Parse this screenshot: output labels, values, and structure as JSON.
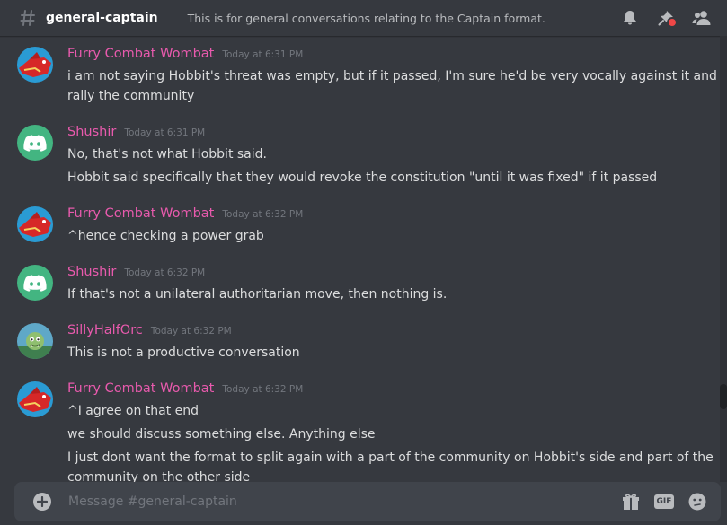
{
  "header": {
    "channel_name": "general-captain",
    "topic": "This is for general conversations relating to the Captain format."
  },
  "icons": {
    "channel": "hash-icon",
    "notifications": "bell-icon",
    "pinned": "pin-icon",
    "members": "members-icon",
    "upload": "plus-icon",
    "gift": "gift-icon",
    "gif": "gif-icon",
    "emoji": "emoji-icon"
  },
  "gif_label": "GIF",
  "colors": {
    "background": "#36393f",
    "username": "#e85aad",
    "discord_green": "#43b581",
    "unread_dot": "#f04747"
  },
  "messages": [
    {
      "author": "Furry Combat Wombat",
      "timestamp": "Today at 6:31 PM",
      "avatar": "wombat",
      "lines": [
        "i am not saying Hobbit's threat was empty, but if it passed, I'm sure he'd be very vocally against it and",
        "rally the community"
      ]
    },
    {
      "author": "Shushir",
      "timestamp": "Today at 6:31 PM",
      "avatar": "discord-default",
      "lines": [
        "No, that's not what Hobbit said.",
        "Hobbit said specifically that they would revoke the constitution \"until it was fixed\" if it passed"
      ]
    },
    {
      "author": "Furry Combat Wombat",
      "timestamp": "Today at 6:32 PM",
      "avatar": "wombat",
      "lines": [
        "^hence checking a power grab"
      ]
    },
    {
      "author": "Shushir",
      "timestamp": "Today at 6:32 PM",
      "avatar": "discord-default",
      "lines": [
        "If that's not a unilateral authoritarian move, then nothing is."
      ]
    },
    {
      "author": "SillyHalfOrc",
      "timestamp": "Today at 6:32 PM",
      "avatar": "orc",
      "lines": [
        "This is not a productive conversation"
      ]
    },
    {
      "author": "Furry Combat Wombat",
      "timestamp": "Today at 6:32 PM",
      "avatar": "wombat",
      "lines": [
        "^I agree on that end",
        "we should discuss something else. Anything else",
        "I just dont want the format to split again with a part of the community on Hobbit's side and part of the",
        "community on the other side"
      ]
    }
  ],
  "composer": {
    "placeholder": "Message #general-captain"
  }
}
